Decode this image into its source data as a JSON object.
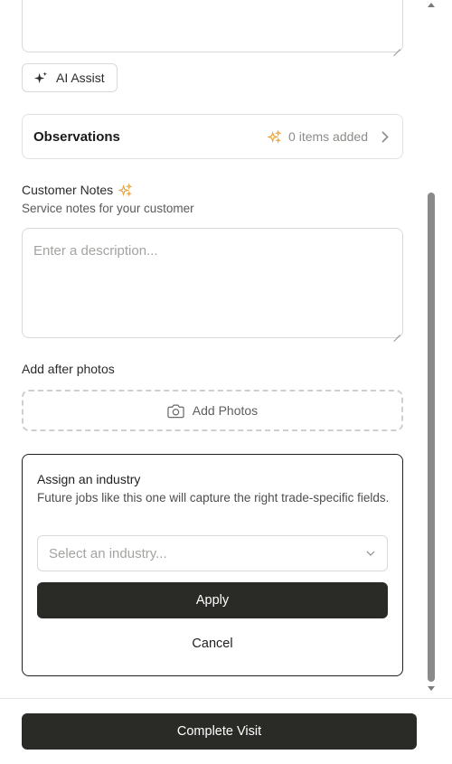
{
  "ai_assist": {
    "label": "AI Assist"
  },
  "observations": {
    "title": "Observations",
    "count_text": "0 items added"
  },
  "customer_notes": {
    "label": "Customer Notes",
    "subtitle": "Service notes for your customer",
    "placeholder": "Enter a description..."
  },
  "after_photos": {
    "label": "Add after photos",
    "button_label": "Add Photos"
  },
  "industry": {
    "title": "Assign an industry",
    "description": "Future jobs like this one will capture the right trade-specific fields.",
    "select_placeholder": "Select an industry...",
    "apply_label": "Apply",
    "cancel_label": "Cancel"
  },
  "footer": {
    "complete_label": "Complete Visit"
  },
  "colors": {
    "accent_sparkle": "#e8a33d",
    "primary_button": "#2a2a27"
  }
}
